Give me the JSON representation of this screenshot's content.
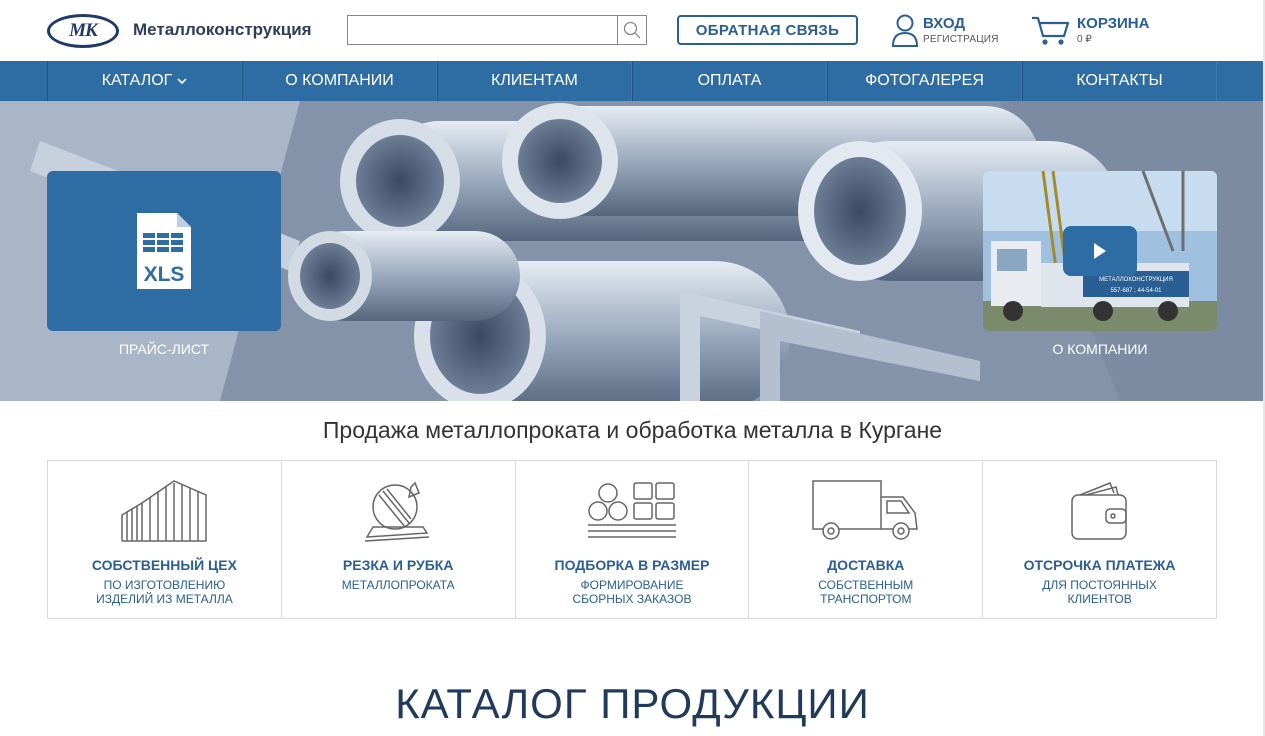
{
  "header": {
    "logo_mark": "МК",
    "brand": "Металлоконструкция",
    "search_placeholder": "",
    "feedback_label": "ОБРАТНАЯ СВЯЗЬ",
    "login_label": "ВХОД",
    "register_label": "РЕГИСТРАЦИЯ",
    "cart_label": "КОРЗИНА",
    "cart_sum": "0 ₽"
  },
  "nav": {
    "items": [
      {
        "label": "КАТАЛОГ",
        "icon": "chevron-down-icon"
      },
      {
        "label": "О КОМПАНИИ"
      },
      {
        "label": "КЛИЕНТАМ"
      },
      {
        "label": "ОПЛАТА"
      },
      {
        "label": "ФОТОГАЛЕРЕЯ"
      },
      {
        "label": "КОНТАКТЫ"
      }
    ]
  },
  "hero": {
    "price_card": {
      "icon": "xls-file-icon",
      "icon_text": "XLS",
      "label": "ПРАЙС-ЛИСТ"
    },
    "video_card": {
      "icon": "play-icon",
      "label": "О КОМПАНИИ",
      "truck_sign": "МЕТАЛЛОКОНСТРУКЦИЯ",
      "truck_phone": "557-687 ; 44-54-01"
    }
  },
  "headline": "Продажа металлопроката и обработка металла в Кургане",
  "features": [
    {
      "icon": "workshop-icon",
      "title": "СОБСТВЕННЫЙ ЦЕХ",
      "sub1": "ПО ИЗГОТОВЛЕНИЮ",
      "sub2": "ИЗДЕЛИЙ ИЗ МЕТАЛЛА"
    },
    {
      "icon": "cutting-saw-icon",
      "title": "РЕЗКА И РУБКА",
      "sub1": "МЕТАЛЛОПРОКАТА",
      "sub2": ""
    },
    {
      "icon": "pipes-stack-icon",
      "title": "ПОДБОРКА В РАЗМЕР",
      "sub1": "ФОРМИРОВАНИЕ",
      "sub2": "СБОРНЫХ ЗАКАЗОВ"
    },
    {
      "icon": "delivery-truck-icon",
      "title": "ДОСТАВКА",
      "sub1": "СОБСТВЕННЫМ",
      "sub2": "ТРАНСПОРТОМ"
    },
    {
      "icon": "wallet-icon",
      "title": "ОТСРОЧКА ПЛАТЕЖА",
      "sub1": "ДЛЯ ПОСТОЯННЫХ",
      "sub2": "КЛИЕНТОВ"
    }
  ],
  "catalog_title": "КАТАЛОГ ПРОДУКЦИИ",
  "colors": {
    "accent": "#2d6da3",
    "text_dark": "#1f3a5a"
  }
}
